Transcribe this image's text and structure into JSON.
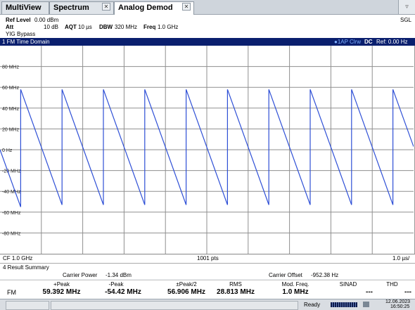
{
  "tabs": [
    {
      "label": "MultiView"
    },
    {
      "label": "Spectrum"
    },
    {
      "label": "Analog Demod"
    }
  ],
  "dropdown_icon": "▿",
  "settings": {
    "ref_level_label": "Ref Level",
    "ref_level_value": "0.00 dBm",
    "att_label": "Att",
    "att_value": "10 dB",
    "aqt_label": "AQT",
    "aqt_value": "10 µs",
    "dbw_label": "DBW",
    "dbw_value": "320 MHz",
    "freq_label": "Freq",
    "freq_value": "1.0 GHz",
    "yig": "YIG Bypass",
    "mode": "SGL"
  },
  "panel": {
    "title": "1 FM Time Domain",
    "trace_marker": "●1AP Clrw",
    "coupling": "DC",
    "ref": "Ref: 0.00 Hz"
  },
  "chart_data": {
    "type": "line",
    "y_tick_labels": [
      "80 MHz",
      "60 MHz",
      "40 MHz",
      "20 MHz",
      "0 Hz",
      "-20 MHz",
      "-40 MHz",
      "-60 MHz",
      "-80 MHz"
    ],
    "y_ticks": [
      80,
      60,
      40,
      20,
      0,
      -20,
      -40,
      -60,
      -80
    ],
    "ylim": [
      -100,
      100
    ],
    "x_range_us": [
      0,
      10
    ],
    "grid": true,
    "line_color": "#2e4fd6",
    "series": [
      {
        "values": [
          {
            "x": 0.0,
            "y": 0
          },
          {
            "x": 0.5,
            "y": -55
          },
          {
            "x": 0.5,
            "y": 58
          },
          {
            "x": 1.5,
            "y": -53
          },
          {
            "x": 1.5,
            "y": 58
          },
          {
            "x": 2.5,
            "y": -53
          },
          {
            "x": 2.5,
            "y": 58
          },
          {
            "x": 3.5,
            "y": -53
          },
          {
            "x": 3.5,
            "y": 58
          },
          {
            "x": 4.5,
            "y": -53
          },
          {
            "x": 4.5,
            "y": 58
          },
          {
            "x": 5.5,
            "y": -53
          },
          {
            "x": 5.5,
            "y": 58
          },
          {
            "x": 6.5,
            "y": -53
          },
          {
            "x": 6.5,
            "y": 58
          },
          {
            "x": 7.5,
            "y": -53
          },
          {
            "x": 7.5,
            "y": 58
          },
          {
            "x": 8.5,
            "y": -53
          },
          {
            "x": 8.5,
            "y": 58
          },
          {
            "x": 9.5,
            "y": -53
          },
          {
            "x": 9.5,
            "y": 58
          },
          {
            "x": 10.0,
            "y": 3
          }
        ]
      }
    ]
  },
  "footer": {
    "cf": "CF 1.0 GHz",
    "pts": "1001 pts",
    "div": "1.0 µs/"
  },
  "result_summary": {
    "title": "4 Result Summary",
    "carrier_power_label": "Carrier Power",
    "carrier_power_value": "-1.34 dBm",
    "carrier_offset_label": "Carrier Offset",
    "carrier_offset_value": "-952.38 Hz",
    "row_label": "FM",
    "columns": [
      {
        "header": "+Peak",
        "value": "59.392 MHz"
      },
      {
        "header": "-Peak",
        "value": "-54.42 MHz"
      },
      {
        "header": "±Peak/2",
        "value": "56.906 MHz"
      },
      {
        "header": "RMS",
        "value": "28.813 MHz"
      },
      {
        "header": "Mod. Freq.",
        "value": "1.0 MHz"
      },
      {
        "header": "SINAD",
        "value": "---"
      },
      {
        "header": "THD",
        "value": "---"
      }
    ]
  },
  "status": {
    "ready": "Ready",
    "date": "12.06.2023",
    "time": "16:50:25"
  }
}
